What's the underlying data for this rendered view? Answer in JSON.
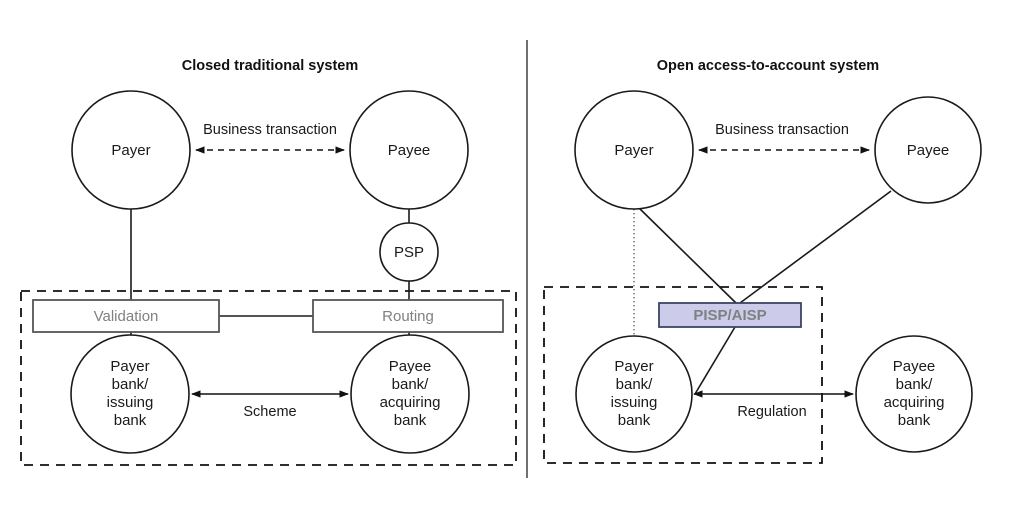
{
  "figure": {
    "background": "#ffffff",
    "accent_fill": "#ccccea",
    "accent_border": "#3c4566",
    "muted_text": "#808080",
    "line_color": "#1a1a1a"
  },
  "panels": {
    "left": {
      "title": "Closed traditional system",
      "nodes": {
        "payer": "Payer",
        "payee": "Payee",
        "psp": "PSP",
        "payer_bank": "Payer\nbank/\nissuing\nbank",
        "payer_bank_lines": [
          "Payer",
          "bank/",
          "issuing",
          "bank"
        ],
        "payee_bank": "Payee\nbank/\nacquiring\nbank",
        "payee_bank_lines": [
          "Payee",
          "bank/",
          "acquiring",
          "bank"
        ]
      },
      "process_boxes": {
        "validation": "Validation",
        "routing": "Routing"
      },
      "edges": {
        "business_transaction": "Business transaction",
        "scheme": "Scheme"
      }
    },
    "right": {
      "title": "Open access-to-account system",
      "nodes": {
        "payer": "Payer",
        "payee": "Payee",
        "payer_bank": "Payer\nbank/\nissuing\nbank",
        "payer_bank_lines": [
          "Payer",
          "bank/",
          "issuing",
          "bank"
        ],
        "payee_bank": "Payee\nbank/\nacquiring\nbank",
        "payee_bank_lines": [
          "Payee",
          "bank/",
          "acquiring",
          "bank"
        ]
      },
      "process_boxes": {
        "pisp_aisp": "PISP/AISP"
      },
      "edges": {
        "business_transaction": "Business transaction",
        "regulation": "Regulation"
      }
    }
  }
}
